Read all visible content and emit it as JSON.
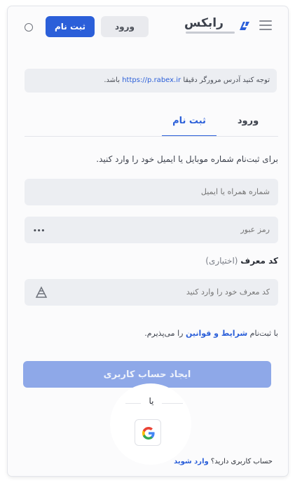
{
  "header": {
    "logo_text": "رابکس",
    "login_button": "ورود",
    "register_button": "ثبت نام"
  },
  "notice": {
    "before": "توجه کنید آدرس مرورگر دقیقا",
    "url": "https://p.rabex.ir",
    "after": "باشد."
  },
  "tabs": {
    "login": "ورود",
    "register": "ثبت نام",
    "active": "register"
  },
  "form": {
    "instruction": "برای ثبت‌نام شماره موبایل یا ایمیل خود را وارد کنید.",
    "phone_placeholder": "شماره همراه یا ایمیل",
    "password_placeholder": "رمز عبور",
    "password_toggle": "•••",
    "referral_label": "کد معرف",
    "referral_optional": "(اختیاری)",
    "referral_placeholder": "کد معرف خود را وارد کنید",
    "terms_before": "با ثبت‌نام",
    "terms_link": "شرایط و قوانین",
    "terms_after": "را می‌پذیرم.",
    "create_button": "ایجاد حساب کاربری",
    "or_text": "یا",
    "have_account": "حساب کاربری دارید؟",
    "login_link": "وارد شوید"
  },
  "colors": {
    "primary": "#2b5fd9",
    "primary_disabled": "#8ea8e8",
    "field_bg": "#eceef2"
  },
  "icons": {
    "menu": "hamburger-icon",
    "theme": "theme-toggle-icon",
    "eye": "eye-icon",
    "referral": "gift-icon",
    "google": "google-icon"
  }
}
